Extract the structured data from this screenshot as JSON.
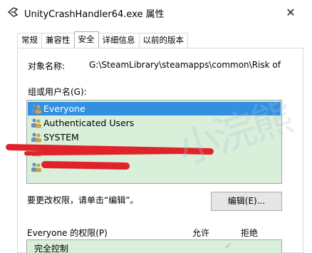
{
  "window": {
    "title": "UnityCrashHandler64.exe 属性",
    "close_label": "✕"
  },
  "tabs": [
    {
      "label": "常规"
    },
    {
      "label": "兼容性"
    },
    {
      "label": "安全"
    },
    {
      "label": "详细信息"
    },
    {
      "label": "以前的版本"
    }
  ],
  "object": {
    "label": "对象名称:",
    "value": "G:\\SteamLibrary\\steamapps\\common\\Risk of Ra"
  },
  "groups": {
    "label": "组或用户名(G):",
    "items": [
      {
        "name": "Everyone",
        "selected": true
      },
      {
        "name": "Authenticated Users",
        "selected": false
      },
      {
        "name": "SYSTEM",
        "selected": false
      }
    ]
  },
  "change": {
    "text": "要更改权限，请单击“编辑”。",
    "edit_button": "编辑(E)..."
  },
  "permissions": {
    "label": "Everyone 的权限(P)",
    "allow": "允许",
    "deny": "拒绝",
    "rows": [
      {
        "name": "完全控制",
        "allow_mark": "✓"
      }
    ]
  },
  "colors": {
    "selection": "#3390e0",
    "list_bg": "#d9efd9",
    "redaction": "#e0222a"
  },
  "watermark": "小浣熊"
}
